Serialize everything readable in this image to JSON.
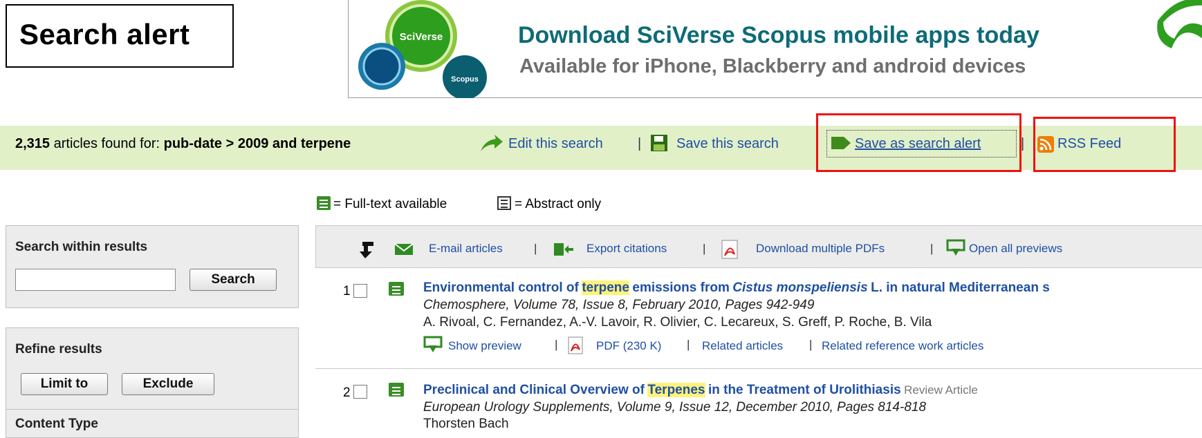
{
  "title_label": "Search alert",
  "banner": {
    "logo_main": "SciVerse",
    "logo_sub": "Scopus",
    "headline": "Download SciVerse Scopus mobile apps today",
    "subline": "Available for iPhone, Blackberry and android devices"
  },
  "results_bar": {
    "count": "2,315",
    "found_text": "articles found for:",
    "query": "pub-date > 2009 and terpene",
    "edit_search": "Edit this search",
    "save_search": "Save this search",
    "save_alert": "Save as search alert",
    "rss_feed": "RSS Feed",
    "separator": "|"
  },
  "legend": {
    "fulltext": "= Full-text available",
    "abstract": "= Abstract only"
  },
  "search_within": {
    "title": "Search within results",
    "input_value": "",
    "button": "Search"
  },
  "refine": {
    "title": "Refine results",
    "limit_button": "Limit to",
    "exclude_button": "Exclude",
    "content_type": "Content Type"
  },
  "toolbar": {
    "email": "E-mail articles",
    "export": "Export citations",
    "download": "Download multiple PDFs",
    "previews": "Open all previews"
  },
  "articles": [
    {
      "number": "1",
      "title_pre": "Environmental control of",
      "title_hl": "terpene",
      "title_mid": "emissions from",
      "title_species": "Cistus monspeliensis",
      "title_post": "L. in natural Mediterranean s",
      "journal": "Chemosphere, Volume 78, Issue 8, February 2010, Pages 942-949",
      "authors": "A. Rivoal, C. Fernandez, A.-V. Lavoir, R. Olivier, C. Lecareux, S. Greff, P. Roche, B. Vila",
      "show_preview": "Show preview",
      "pdf": "PDF (230 K)",
      "related": "Related articles",
      "related_ref": "Related reference work articles"
    },
    {
      "number": "2",
      "title_pre": "Preclinical and Clinical Overview of",
      "title_hl": "Terpenes",
      "title_post": "in the Treatment of Urolithiasis",
      "type": "Review Article",
      "journal": "European Urology Supplements, Volume 9, Issue 12, December 2010, Pages 814-818",
      "authors": "Thorsten Bach"
    }
  ],
  "colors": {
    "green_bar": "#e2f0c8",
    "link": "#1f4fa3",
    "highlight": "#fff27a",
    "callout_red": "#e11111"
  }
}
